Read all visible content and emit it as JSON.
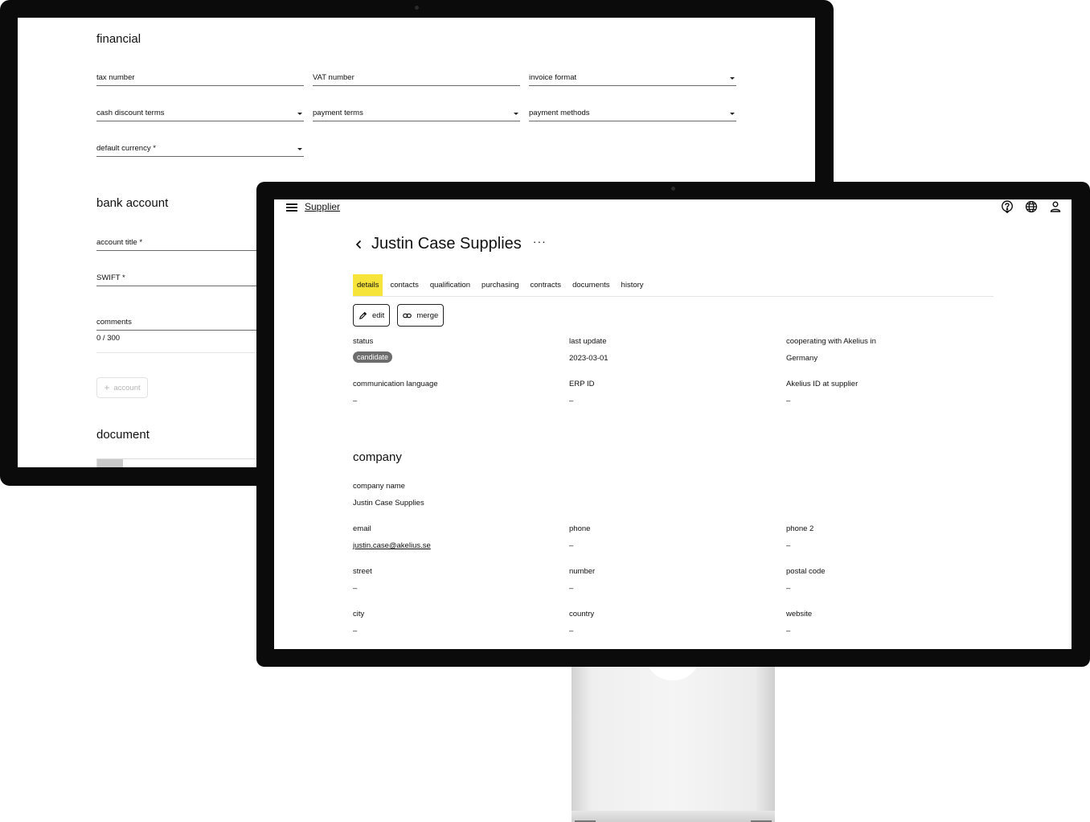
{
  "back_screen": {
    "financial_title": "financial",
    "fields_row1": [
      "tax number",
      "VAT number",
      "invoice format"
    ],
    "fields_row2": [
      "cash discount terms",
      "payment terms",
      "payment methods"
    ],
    "default_currency": "default currency *",
    "bank_account_title": "bank account",
    "account_title": "account title *",
    "swift": "SWIFT *",
    "comments": "comments",
    "comments_counter": "0 / 300",
    "add_account_label": "account",
    "document_title": "document"
  },
  "topbar": {
    "app_title": "Supplier",
    "icons": [
      "help-icon",
      "globe-icon",
      "user-icon"
    ]
  },
  "page": {
    "title": "Justin Case Supplies",
    "more": "···"
  },
  "tabs": [
    "details",
    "contacts",
    "qualification",
    "purchasing",
    "contracts",
    "documents",
    "history"
  ],
  "active_tab": "details",
  "actions": {
    "edit_label": "edit",
    "merge_label": "merge"
  },
  "details": {
    "status_label": "status",
    "status_value": "candidate",
    "last_update_label": "last update",
    "last_update_value": "2023-03-01",
    "cooperating_label": "cooperating with Akelius in",
    "cooperating_value": "Germany",
    "comm_lang_label": "communication language",
    "comm_lang_value": "–",
    "erp_id_label": "ERP ID",
    "erp_id_value": "–",
    "akelius_id_label": "Akelius ID at supplier",
    "akelius_id_value": "–"
  },
  "company": {
    "title": "company",
    "company_name_label": "company name",
    "company_name_value": "Justin Case Supplies",
    "email_label": "email",
    "email_value": "justin.case@akelius.se",
    "phone_label": "phone",
    "phone_value": "–",
    "phone2_label": "phone 2",
    "phone2_value": "–",
    "street_label": "street",
    "street_value": "–",
    "number_label": "number",
    "number_value": "–",
    "postal_label": "postal code",
    "postal_value": "–",
    "city_label": "city",
    "city_value": "–",
    "country_label": "country",
    "country_value": "–",
    "website_label": "website",
    "website_value": "–"
  },
  "colors": {
    "active_tab": "#f7e43a",
    "badge": "#6d6d6d",
    "bezel": "#0b0b0b"
  }
}
